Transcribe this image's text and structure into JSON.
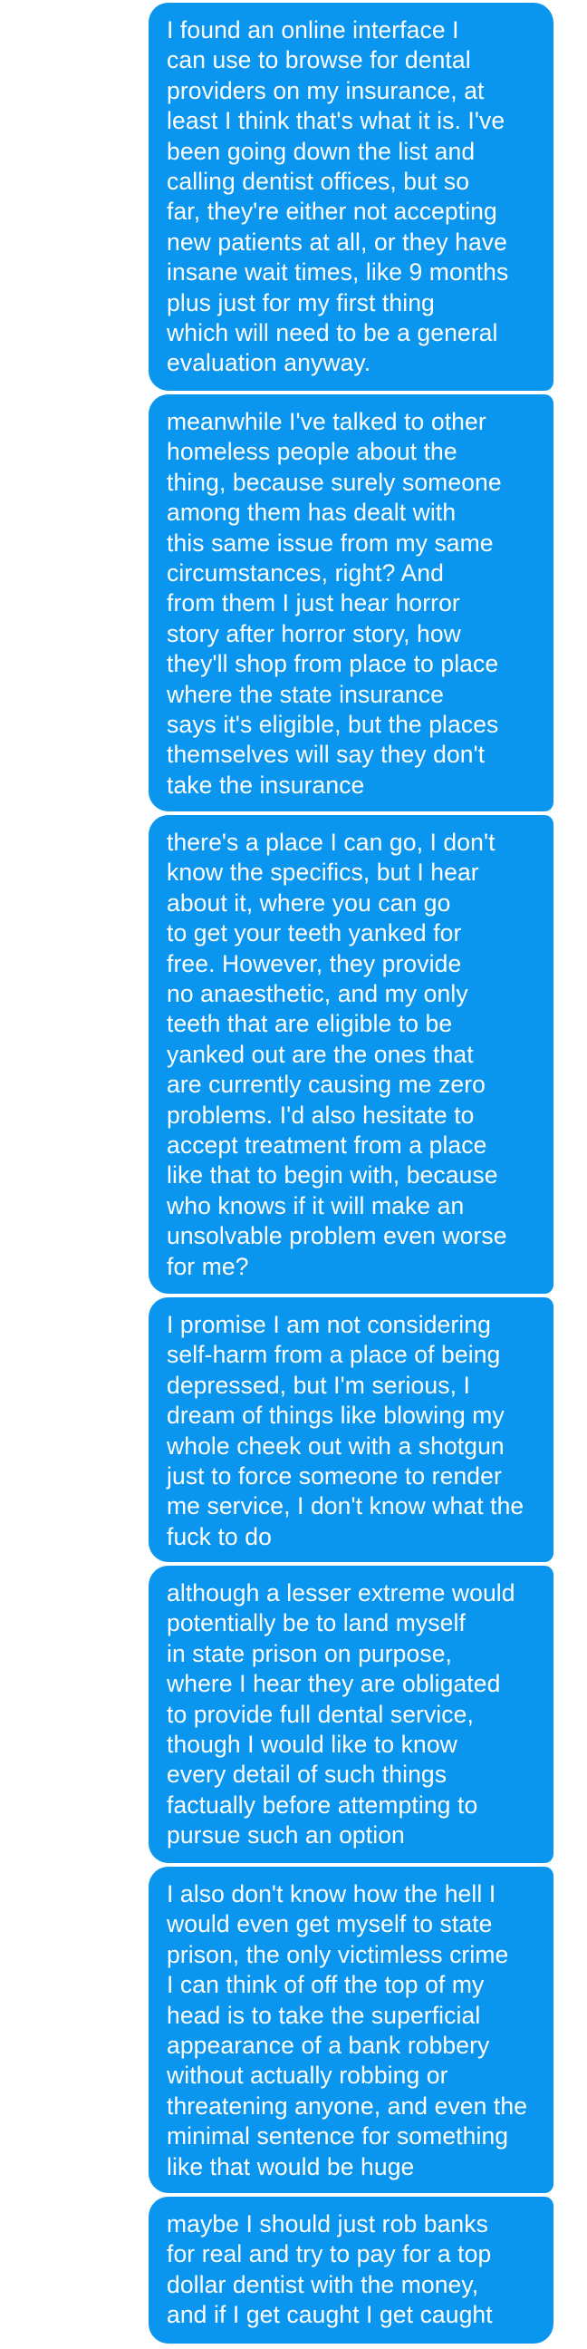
{
  "messages": [
    {
      "text": "I found an online interface I\ncan use to browse for dental\nproviders on my insurance, at\nleast I think that's what it is. I've\nbeen going down the list and\ncalling dentist offices, but so\nfar, they're either not accepting\nnew patients at all, or they have\ninsane wait times, like 9 months\nplus just for my first thing\nwhich will need to be a general\nevaluation anyway."
    },
    {
      "text": "meanwhile I've talked to other\nhomeless people about the\nthing, because surely someone\namong them has dealt with\nthis same issue from my same\ncircumstances, right? And\nfrom them I just hear horror\nstory after horror story, how\nthey'll shop from place to place\nwhere the state insurance\nsays it's eligible, but the places\nthemselves will say they don't\ntake the insurance"
    },
    {
      "text": "there's a place I can go, I don't\nknow the specifics, but I hear\nabout it, where you can go\nto get your teeth yanked for\nfree. However, they provide\nno anaesthetic, and my only\nteeth that are eligible to be\nyanked out are the ones that\nare currently causing me zero\nproblems. I'd also hesitate to\naccept treatment from a place\nlike that to begin with, because\nwho knows if it will make an\nunsolvable problem even worse\nfor me?"
    },
    {
      "text": "I promise I am not considering\nself-harm from a place of being\ndepressed, but I'm serious, I\ndream of things like blowing my\nwhole cheek out with a shotgun\njust to force someone to render\nme service, I don't know what the\nfuck to do"
    },
    {
      "text": "although a lesser extreme would\npotentially be to land myself\nin state prison on purpose,\nwhere I hear they are obligated\nto provide full dental service,\nthough I would like to know\nevery detail of such things\nfactually before attempting to\npursue such an option"
    },
    {
      "text": "I also don't know how the hell I\nwould even get myself to state\nprison, the only victimless crime\nI can think of off the top of my\nhead is to take the superficial\nappearance of a bank robbery\nwithout actually robbing or\nthreatening anyone, and even the\nminimal sentence for something\nlike that would be huge"
    },
    {
      "text": "maybe I should just rob banks\nfor real and try to pay for a top\ndollar dentist with the money,\nand if I get caught I get caught"
    }
  ],
  "colors": {
    "bubble_background": "#0a95ef",
    "bubble_text": "#ffffff",
    "page_background": "#ffffff"
  }
}
